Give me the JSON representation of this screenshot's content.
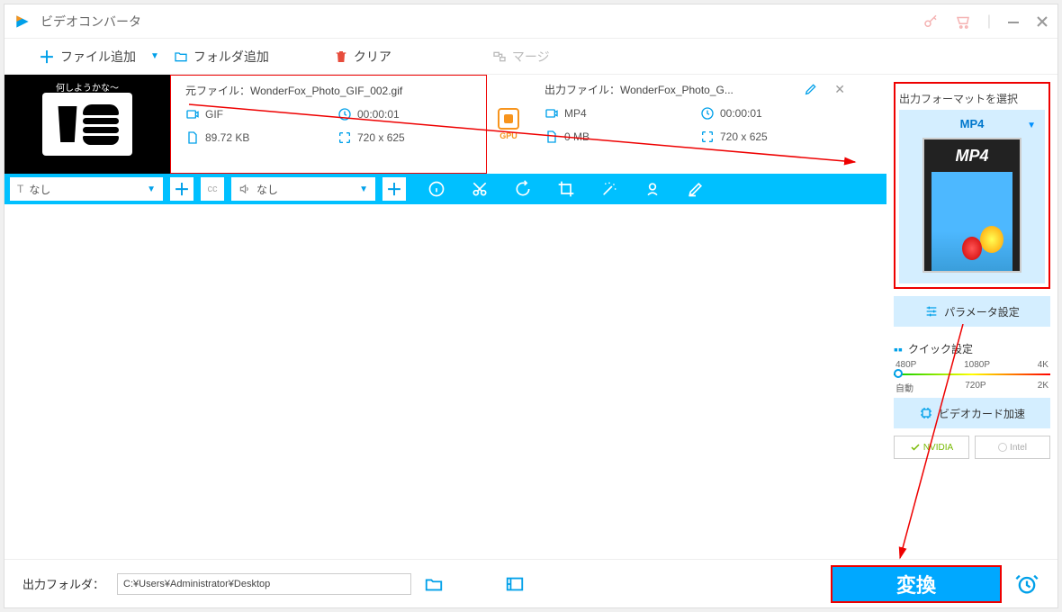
{
  "title": "ビデオコンバータ",
  "toolbar": {
    "add_file": "ファイル追加",
    "add_folder": "フォルダ追加",
    "clear": "クリア",
    "merge": "マージ"
  },
  "file": {
    "thumb_caption": "何しようかな～",
    "src_label": "元ファイル：",
    "src_name": "WonderFox_Photo_GIF_002.gif",
    "src_format": "GIF",
    "src_duration": "00:00:01",
    "src_size": "89.72 KB",
    "src_res": "720 x 625",
    "gpu_label": "GPU",
    "out_label": "出力ファイル：",
    "out_name": "WonderFox_Photo_G...",
    "out_format": "MP4",
    "out_duration": "00:00:01",
    "out_size": "0 MB",
    "out_res": "720 x 625"
  },
  "subs": {
    "sub_none": "なし",
    "audio_none": "なし"
  },
  "sidebar": {
    "select_format": "出力フォーマットを選択",
    "format": "MP4",
    "mp4_badge": "MP4",
    "params": "パラメータ設定",
    "quick": "クイック設定",
    "q_480": "480P",
    "q_1080": "1080P",
    "q_4k": "4K",
    "q_auto": "自動",
    "q_720": "720P",
    "q_2k": "2K",
    "gpu_accel": "ビデオカード加速",
    "nvidia": "NVIDIA",
    "intel": "Intel"
  },
  "bottom": {
    "out_folder_label": "出力フォルダ：",
    "out_folder": "C:¥Users¥Administrator¥Desktop",
    "convert": "変換"
  }
}
